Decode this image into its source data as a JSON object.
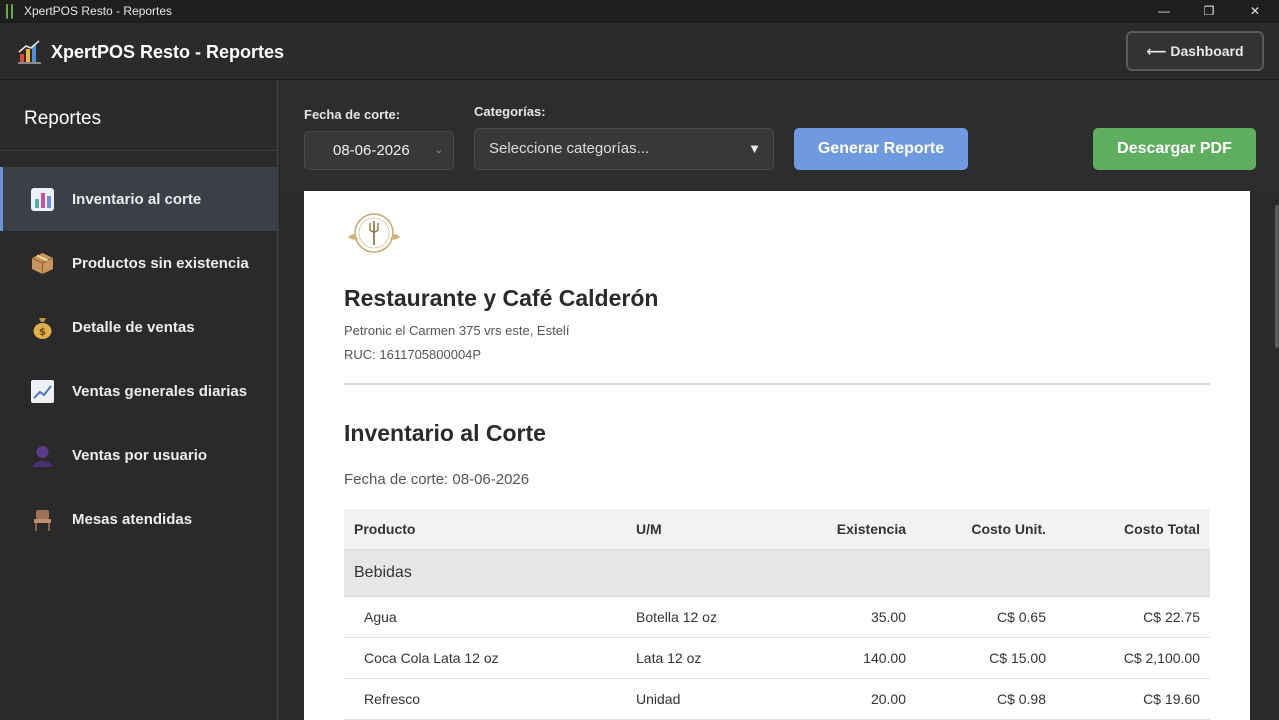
{
  "window": {
    "title": "XpertPOS Resto - Reportes",
    "minimize": "—",
    "restore": "❐",
    "close": "✕"
  },
  "header": {
    "title": "XpertPOS Resto - Reportes",
    "dashboard_button": "⟵ Dashboard"
  },
  "sidebar": {
    "title": "Reportes",
    "items": [
      {
        "label": "Inventario al corte",
        "icon": "bar-chart-icon",
        "active": true
      },
      {
        "label": "Productos sin existencia",
        "icon": "package-icon",
        "active": false
      },
      {
        "label": "Detalle de ventas",
        "icon": "money-bag-icon",
        "active": false
      },
      {
        "label": "Ventas generales diarias",
        "icon": "trend-chart-icon",
        "active": false
      },
      {
        "label": "Ventas por usuario",
        "icon": "user-icon",
        "active": false
      },
      {
        "label": "Mesas atendidas",
        "icon": "chair-icon",
        "active": false
      }
    ]
  },
  "toolbar": {
    "date_label": "Fecha de corte:",
    "date_value": "08-06-2026",
    "category_label": "Categorías:",
    "category_placeholder": "Seleccione categorías...",
    "generate_button": "Generar Reporte",
    "pdf_button": "Descargar PDF"
  },
  "report": {
    "business_name": "Restaurante y Café Calderón",
    "address": "Petronic el Carmen 375 vrs este, Estelí",
    "ruc": "RUC: 1611705800004P",
    "title": "Inventario al Corte",
    "date_line": "Fecha de corte: 08-06-2026",
    "columns": [
      "Producto",
      "U/M",
      "Existencia",
      "Costo Unit.",
      "Costo Total"
    ],
    "categories": [
      {
        "name": "Bebidas",
        "rows": [
          {
            "producto": "Agua",
            "um": "Botella 12 oz",
            "existencia": "35.00",
            "costo_unit": "C$ 0.65",
            "costo_total": "C$ 22.75"
          },
          {
            "producto": "Coca Cola Lata 12 oz",
            "um": "Lata 12 oz",
            "existencia": "140.00",
            "costo_unit": "C$ 15.00",
            "costo_total": "C$ 2,100.00"
          },
          {
            "producto": "Refresco",
            "um": "Unidad",
            "existencia": "20.00",
            "costo_unit": "C$ 0.98",
            "costo_total": "C$ 19.60"
          }
        ]
      }
    ]
  },
  "colors": {
    "accent_blue": "#6f9ae0",
    "accent_green": "#5fae5f",
    "sidebar_active": "#3b3f48"
  }
}
